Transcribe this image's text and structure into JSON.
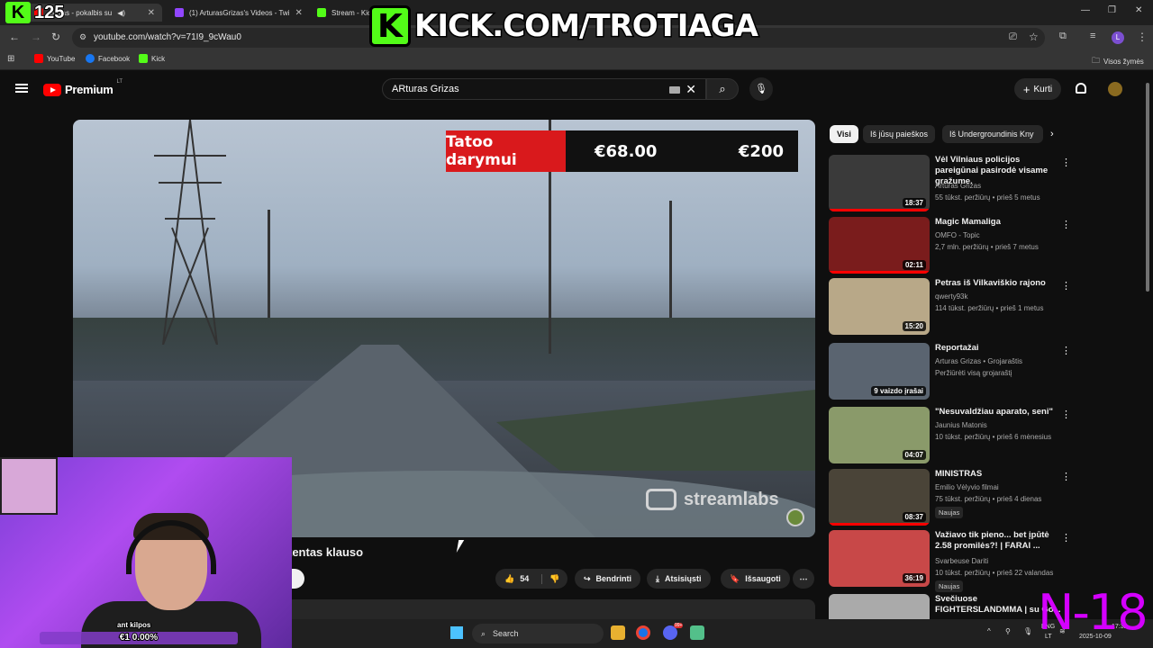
{
  "browser": {
    "tabs": [
      {
        "label": "Grizas - pokalbis su",
        "active": true,
        "favicon": "youtube-icon"
      },
      {
        "label": "(1) ArturasGrizas's Videos - Twi",
        "active": false,
        "favicon": "twitch-icon"
      },
      {
        "label": "Stream - Kic",
        "active": false,
        "favicon": "kick-icon"
      }
    ],
    "url": "youtube.com/watch?v=71I9_9cWau0",
    "bookmarks": [
      "YouTube",
      "Facebook",
      "Kick"
    ],
    "all_bookmarks_label": "Visos žymės",
    "profile_initial": "L"
  },
  "overlay": {
    "viewer_icon": "K",
    "viewer_count": "125",
    "kick_logo": "K",
    "kick_url": "KICK.COM/TROTIAGA",
    "goal_label": "Tatoo darymui",
    "goal_current": "€68.00",
    "goal_target": "€200",
    "streamlabs_label": "streamlabs",
    "webcam_goal_title": "ant kilpos",
    "webcam_goal_text": "€1 0.00%",
    "webcam_goal_fraction": 0.0,
    "corner_text": "N-18"
  },
  "youtube": {
    "logo_word": "Premium",
    "country": "LT",
    "search_query": "ARturas Grizas",
    "create_label": "Kurti",
    "video_title": "tentas klauso",
    "likes": "54",
    "actions": {
      "share": "Bendrinti",
      "download": "Atsisiųsti",
      "save": "Išsaugoti"
    },
    "chips": [
      "Visi",
      "Iš jūsų paieškos",
      "Iš Undergroundinis Kny"
    ],
    "recommendations": [
      {
        "title": "Vėl Vilniaus policijos pareigūnai pasirodė visame gražume.",
        "channel": "Arturas Grizas",
        "meta": "55 tūkst. peržiūrų • prieš 5 metus",
        "duration": "18:37",
        "thumb_color": "#3a3a3a",
        "progress": 1.0
      },
      {
        "title": "Magic Mamaliga",
        "channel": "OMFO - Topic",
        "meta": "2,7 mln. peržiūrų • prieš 7 metus",
        "duration": "02:11",
        "thumb_color": "#7a1c1c",
        "progress": 1.0
      },
      {
        "title": "Petras iš Vilkaviškio rajono",
        "channel": "qwerty93k",
        "meta": "114 tūkst. peržiūrų • prieš 1 metus",
        "duration": "15:20",
        "thumb_color": "#b8a888",
        "progress": 0.0
      },
      {
        "title": "Reportažai",
        "channel": "Arturas Grizas • Grojaraštis",
        "meta": "Peržiūrėti visą grojaraštį",
        "duration": "9 vaizdo įrašai",
        "thumb_color": "#5a6470",
        "progress": 0.0
      },
      {
        "title": "\"Nesuvaldžiau aparato, seni\"",
        "channel": "Jaunius Matonis",
        "meta": "10 tūkst. peržiūrų • prieš 6 mėnesius",
        "duration": "04:07",
        "thumb_color": "#8a9a6a",
        "progress": 0.0
      },
      {
        "title": "MINISTRAS",
        "channel": "Emilio Vėlyvio filmai",
        "meta": "75 tūkst. peržiūrų • prieš 4 dienas",
        "duration": "08:37",
        "thumb_color": "#4a4438",
        "progress": 1.0,
        "badge": "Naujas"
      },
      {
        "title": "Važiavo tik pieno... bet įpūtė 2.58 promilės?! | FARAI ...",
        "channel": "Svarbeuse Dariti",
        "meta": "10 tūkst. peržiūrų • prieš 22 valandas",
        "duration": "36:19",
        "thumb_color": "#c84848",
        "progress": 0.0,
        "badge": "Naujas"
      },
      {
        "title": "Svečiuose FIGHTERSLANDMMA | su Go...",
        "channel": "",
        "meta": "",
        "duration": "",
        "thumb_color": "#aaaaaa",
        "progress": 0.0
      }
    ]
  },
  "taskbar": {
    "search_label": "Search",
    "lang": "ENG",
    "lang_sub": "LT",
    "date": "2025-10-09",
    "time": "17:32",
    "discord_badge": "99+"
  },
  "colors": {
    "kick_green": "#53fc18",
    "yt_red": "#ff0000",
    "goal_red": "#d9191c",
    "webcam_purple": "#b04cf0",
    "n18_magenta": "#d400ff"
  }
}
